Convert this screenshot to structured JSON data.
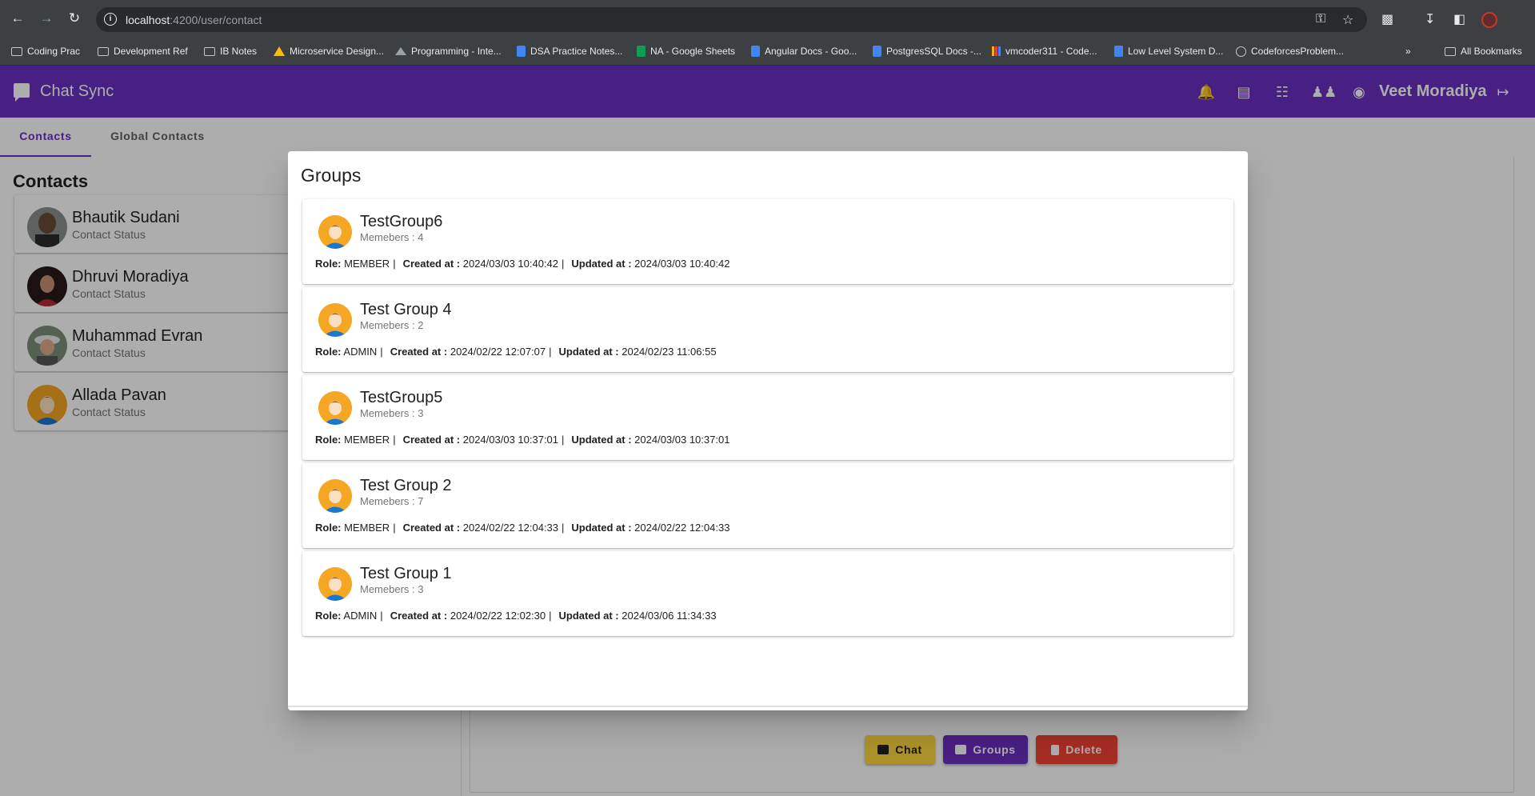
{
  "browser": {
    "url_host": "localhost",
    "url_path": ":4200/user/contact",
    "bookmarks": [
      {
        "label": "Coding Prac",
        "icon": "folder"
      },
      {
        "label": "Development Ref",
        "icon": "folder"
      },
      {
        "label": "IB Notes",
        "icon": "folder"
      },
      {
        "label": "Microservice Design...",
        "icon": "drive"
      },
      {
        "label": "Programming - Inte...",
        "icon": "mountain"
      },
      {
        "label": "DSA Practice Notes...",
        "icon": "doc"
      },
      {
        "label": "NA - Google Sheets",
        "icon": "sheet"
      },
      {
        "label": "Angular Docs - Goo...",
        "icon": "doc"
      },
      {
        "label": "PostgresSQL Docs -...",
        "icon": "doc"
      },
      {
        "label": "vmcoder311 - Code...",
        "icon": "bars"
      },
      {
        "label": "Low Level System D...",
        "icon": "doc"
      },
      {
        "label": "CodeforcesProblem...",
        "icon": "globe"
      }
    ],
    "all_bookmarks": "All Bookmarks"
  },
  "app": {
    "title": "Chat Sync",
    "user_name": "Veet Moradiya",
    "accent_color": "#6a2fc0"
  },
  "tabs": [
    {
      "label": "Contacts",
      "active": true
    },
    {
      "label": "Global Contacts",
      "active": false
    }
  ],
  "contacts": {
    "heading": "Contacts",
    "items": [
      {
        "name": "Bhautik Sudani",
        "status": "Contact Status"
      },
      {
        "name": "Dhruvi Moradiya",
        "status": "Contact Status"
      },
      {
        "name": "Muhammad Evran",
        "status": "Contact Status"
      },
      {
        "name": "Allada Pavan",
        "status": "Contact Status"
      }
    ]
  },
  "actions": {
    "chat": "Chat",
    "groups": "Groups",
    "delete": "Delete"
  },
  "dialog": {
    "title": "Groups",
    "labels": {
      "role": "Role:",
      "created": "Created at :",
      "updated": "Updated at :",
      "separator": "|"
    },
    "groups": [
      {
        "name": "TestGroup6",
        "members": "Memebers : 4",
        "role": "MEMBER",
        "created": "2024/03/03 10:40:42",
        "updated": "2024/03/03 10:40:42"
      },
      {
        "name": "Test Group 4",
        "members": "Memebers : 2",
        "role": "ADMIN",
        "created": "2024/02/22 12:07:07",
        "updated": "2024/02/23 11:06:55"
      },
      {
        "name": "TestGroup5",
        "members": "Memebers : 3",
        "role": "MEMBER",
        "created": "2024/03/03 10:37:01",
        "updated": "2024/03/03 10:37:01"
      },
      {
        "name": "Test Group 2",
        "members": "Memebers : 7",
        "role": "MEMBER",
        "created": "2024/02/22 12:04:33",
        "updated": "2024/02/22 12:04:33"
      },
      {
        "name": "Test Group 1",
        "members": "Memebers : 3",
        "role": "ADMIN",
        "created": "2024/02/22 12:02:30",
        "updated": "2024/03/06 11:34:33"
      }
    ]
  }
}
